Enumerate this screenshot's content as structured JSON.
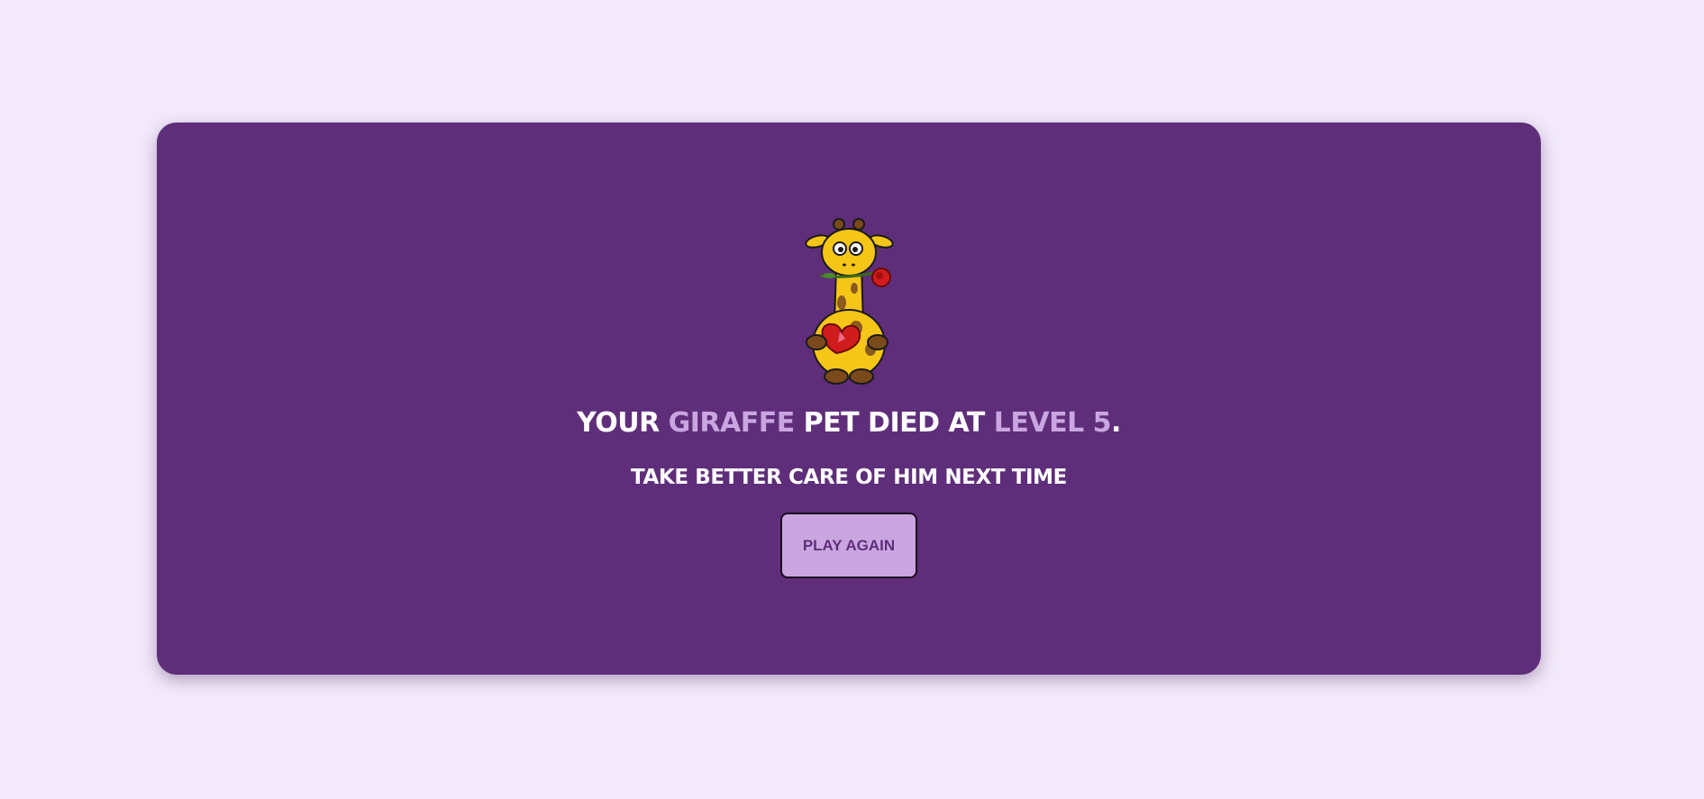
{
  "game_over": {
    "headline": {
      "prefix": "YOUR ",
      "pet_type": "GIRAFFE",
      "middle": " PET DIED AT ",
      "level": "LEVEL 5",
      "suffix": "."
    },
    "subline": "TAKE BETTER CARE OF HIM NEXT TIME",
    "play_again_label": "PLAY AGAIN",
    "pet_image_icon": "giraffe-with-rose-and-heart-icon"
  },
  "colors": {
    "page_background": "#f2eafa",
    "card_background": "#5f2e7a",
    "accent": "#c9a6e0",
    "text": "#ffffff"
  }
}
